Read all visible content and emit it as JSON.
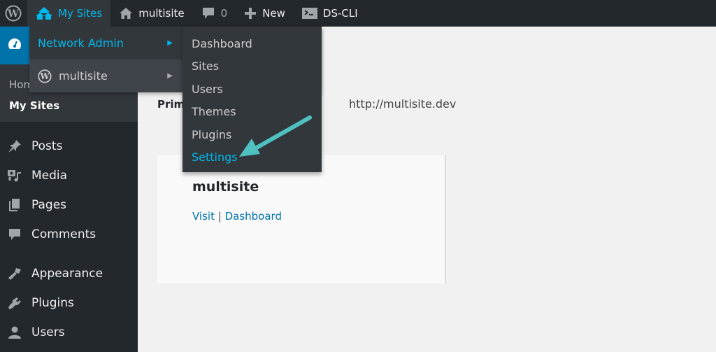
{
  "adminbar": {
    "items": [
      {
        "icon": "wordpress-logo-icon",
        "label": ""
      },
      {
        "icon": "my-sites-icon",
        "label": "My Sites"
      },
      {
        "icon": "home-icon",
        "label": "multisite"
      },
      {
        "icon": "comment-icon",
        "label": "0"
      },
      {
        "icon": "plus-icon",
        "label": "New"
      },
      {
        "icon": "terminal-icon",
        "label": "DS-CLI"
      }
    ]
  },
  "my_sites_menu": {
    "items": [
      {
        "label": "Network Admin",
        "icon": ""
      },
      {
        "label": "multisite",
        "icon": "wordpress-logo-icon"
      }
    ],
    "network_admin_submenu": [
      "Dashboard",
      "Sites",
      "Users",
      "Themes",
      "Plugins",
      "Settings"
    ]
  },
  "sidebar": {
    "submenu": [
      "Home",
      "My Sites"
    ],
    "items": [
      {
        "label": "Posts",
        "icon": "pin-icon"
      },
      {
        "label": "Media",
        "icon": "media-icon"
      },
      {
        "label": "Pages",
        "icon": "pages-icon"
      },
      {
        "label": "Comments",
        "icon": "comment-icon"
      },
      {
        "label": "Appearance",
        "icon": "paintbrush-icon"
      },
      {
        "label": "Plugins",
        "icon": "plug-icon"
      },
      {
        "label": "Users",
        "icon": "user-icon"
      }
    ]
  },
  "content": {
    "primary_site_label": "Primary Site",
    "primary_site_url": "http://multisite.dev",
    "site_card": {
      "name": "multisite",
      "visit_label": "Visit",
      "separator": "|",
      "dashboard_label": "Dashboard"
    }
  },
  "annotation": {
    "color": "#4fc1c1"
  }
}
